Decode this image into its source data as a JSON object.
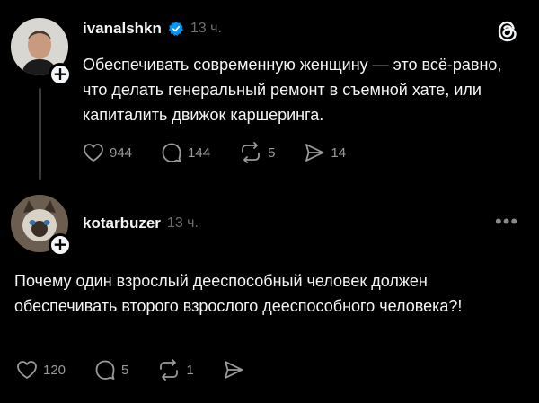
{
  "app": {
    "logo_icon": "threads-logo-icon"
  },
  "posts": [
    {
      "username": "ivanalshkn",
      "verified": true,
      "time": "13 ч.",
      "text": "Обеспечивать современную женщину — это всё-равно, что делать генеральный ремонт в съемной хате, или капиталить движок каршеринга.",
      "actions": {
        "likes": "944",
        "comments": "144",
        "reposts": "5",
        "shares": "14"
      }
    },
    {
      "username": "kotarbuzer",
      "verified": false,
      "time": "13 ч.",
      "text": "Почему один взрослый дееспособный человек должен обеспечивать второго взрослого дееспособного человека?!",
      "actions": {
        "likes": "120",
        "comments": "5",
        "reposts": "1"
      }
    }
  ],
  "icons": {
    "like": "heart-icon",
    "comment": "comment-bubble-icon",
    "repost": "repost-icon",
    "share": "send-icon",
    "more": "more-dots-icon",
    "add": "plus-icon",
    "verified": "verified-badge-icon"
  },
  "colors": {
    "background": "#000000",
    "text": "#f3f5f7",
    "muted": "#6f6f6f",
    "verified": "#0095f6"
  }
}
